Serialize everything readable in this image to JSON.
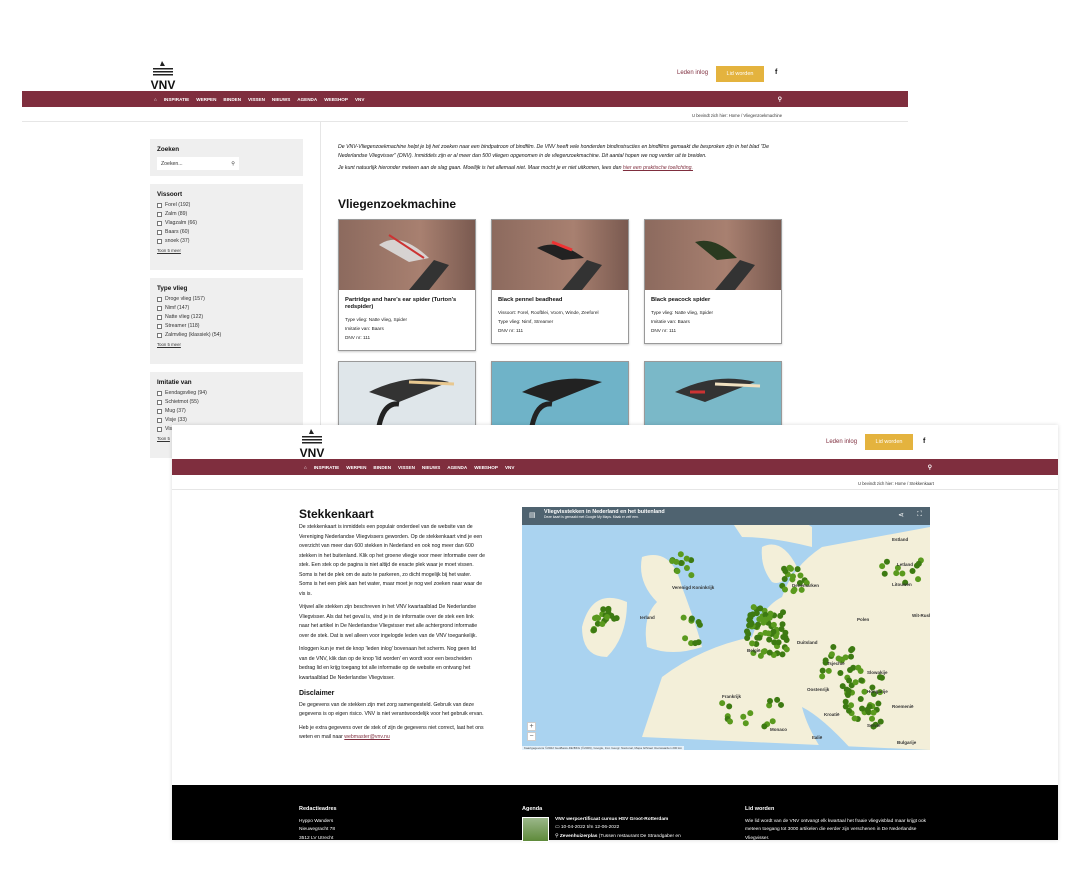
{
  "brand": {
    "logo_text": "VNV",
    "nav_color": "#7f2e3e",
    "accent": "#e4b33e"
  },
  "header": {
    "login": "Leden inlog",
    "join": "Lid worden",
    "facebook": "f"
  },
  "nav": {
    "items": [
      "INSPIRATIE",
      "WERPEN",
      "BINDEN",
      "VISSEN",
      "NIEUWS",
      "AGENDA",
      "WEBSHOP",
      "VNV"
    ]
  },
  "page1": {
    "breadcrumb": "U bevindt zich hier: Home / Vliegenzoekmachine",
    "intro1": "De VNV-Vliegenzoekmachine helpt je bij het zoeken naar een bindpatroon of bindfilm. De VNV heeft vele honderden bindinstructies en bindfilms gemaakt die besproken zijn in het blad \"De Nederlandse Vliegvisser\" (DNV). Inmiddels zijn er al meer dan 500 vliegen opgenomen in de vliegenzoekmachine. Dit aantal hopen we nog verder uit te breiden.",
    "intro2": "Je kunt natuurlijk hieronder meteen aan de slag gaan. Moeilijk is het allemaal niet. Maar mocht je er niet uitkomen, lees dan ",
    "intro2_link": "hier een praktische toelichting.",
    "title": "Vliegenzoekmachine",
    "search": {
      "title": "Zoeken",
      "placeholder": "Zoeken..."
    },
    "filters": [
      {
        "title": "Vissoort",
        "options": [
          "Forel (192)",
          "Zalm (89)",
          "Vlagzalm (66)",
          "Baars (60)",
          "snoek (37)"
        ],
        "more": "Toon 5 meer"
      },
      {
        "title": "Type vlieg",
        "options": [
          "Droge vlieg (157)",
          "Nimf (147)",
          "Natte vlieg (122)",
          "Streamer (118)",
          "Zalmvlieg (klassiek) (54)"
        ],
        "more": "Toon 5 meer"
      },
      {
        "title": "Imitatie van",
        "options": [
          "Eendagsvlieg (94)",
          "Schietmot (55)",
          "Mug (37)",
          "Visje (33)",
          "Vis"
        ],
        "more": "Toon 5"
      }
    ],
    "cards": [
      {
        "title": "Partridge and hare's ear spider (Turton's redspider)",
        "lines": [
          "Type vlieg: Natte vlieg, Spider",
          "Imitatie van: Baars",
          "DNV nr: 111"
        ]
      },
      {
        "title": "Black pennel beadhead",
        "lines": [
          "Vissoort: Forel, Roofblei, Voorn, Winde, Zeeforel",
          "Type vlieg: Nimf, Streamer",
          "DNV nr: 111"
        ]
      },
      {
        "title": "Black peacock spider",
        "lines": [
          "Type vlieg: Natte vlieg, Spider",
          "Imitatie van: Baars",
          "DNV nr: 111"
        ]
      }
    ]
  },
  "page2": {
    "breadcrumb": "U bevindt zich hier: Home / Stekkenkaart",
    "title": "Stekkenkaart",
    "paragraphs": [
      "De stekkenkaart is inmiddels een populair onderdeel van de website van de Vereniging Nederlandse Vliegvissers geworden. Op de stekkenkaart vind je een overzicht van meer dan 600 stekken in Nederland en ook nog meer dan 600 stekken in het buitenland. Klik op het groene vliegje voor meer informatie over de stek. Een stek op de pagina is niet altijd de exacte plek waar je moet vissen. Soms is het de plek om de auto te parkeren, zo dicht mogelijk bij het water. Soms is het een plek aan het water, maar moet je nog wel zoeken naar waar de vis is.",
      "Vrijwel alle stekken zijn beschreven in het VNV kwartaalblad De Nederlandse Vliegvisser. Als dat het geval is, vind je in de informatie over de stek een link naar het artikel in De Nederlandse Vliegvisser met alle achtergrond informatie over de stek. Dat is wel alleen voor ingelogde leden van de VNV toegankelijk.",
      "Inloggen kun je met de knop 'leden inlog' bovenaan het scherm. Nog geen lid van de VNV, klik dan op de knop 'lid worden' en wordt voor een bescheiden bedrag lid en krijg toegang tot alle informatie op de website en ontvang het kwartaalblad De Nederlandse Vliegvisser."
    ],
    "disclaimer_title": "Disclaimer",
    "disclaimer": "De gegevens van de stekken zijn met zorg samengesteld. Gebruik van deze gegevens is op eigen risico. VNV is niet verantwoordelijk voor het gebruik ervan.",
    "contact": "Heb je extra gegevens over de stek of zijn de gegevens niet correct, laat het ons weten en mail naar ",
    "contact_link": "webmaster@vnv.nu",
    "map": {
      "title": "Vliegvisstekken in Nederland en het buitenland",
      "subtitle": "Deze kaart is gemaakt met Google My Maps. Maak er zelf een.",
      "labels": [
        "Estland",
        "Letland",
        "Litouwen",
        "Verenigd Koninkrijk",
        "Ierland",
        "Denemarken",
        "Polen",
        "Duitsland",
        "België",
        "Tsjechië",
        "Slowakije",
        "Frankrijk",
        "Oostenrijk",
        "Hongarije",
        "Roemenië",
        "Kroatië",
        "Servië",
        "Monaco",
        "Italië",
        "Bulgarije",
        "Wit-Rusland"
      ],
      "attribution": "Kaartgegevens ©2022 GeoBasis-DE/BKG (©2009), Google, Inst. Geogr. Nacional, Mapa GISrael  Voorwaarden  200 km",
      "zoom_in": "+",
      "zoom_out": "−"
    },
    "footer": {
      "col1": {
        "title": "Redactieadres",
        "lines": [
          "Hyppo Wanders",
          "Nieuwegracht 78",
          "3512 LV Utrecht"
        ]
      },
      "col2": {
        "title": "Agenda",
        "event": "VNV werpcertificaat cursus HSV Groot-Rotterdam",
        "date": "10-04-2022 t/m 12-06-2022",
        "place": "Zevenhuizerplas",
        "place_rest": " (Tussen restaurant De Strandgaber en"
      },
      "col3": {
        "title": "Lid worden",
        "text": "Wie lid wordt van de VNV ontvangt elk kwartaal het fraaie vliegvisblad maar krijgt ook meteen toegang tot 3000 artikelen die eerder zijn verschenen in De Nederlandse Vliegvisser."
      }
    }
  }
}
